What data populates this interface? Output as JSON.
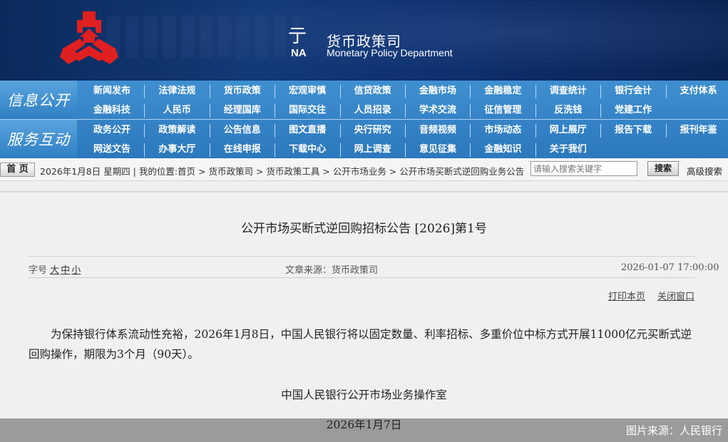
{
  "header": {
    "partial_char": "亍",
    "partial_na": "NA",
    "dept_cn": "货币政策司",
    "dept_en": "Monetary Policy Department",
    "logo_color": "#e02020"
  },
  "nav": {
    "groups": [
      {
        "title": "信息公开",
        "row1": [
          "新闻发布",
          "法律法规",
          "货币政策",
          "宏观审慎",
          "信贷政策",
          "金融市场",
          "金融稳定",
          "调查统计",
          "银行会计",
          "支付体系"
        ],
        "row2": [
          "金融科技",
          "人民币",
          "经理国库",
          "国际交往",
          "人员招录",
          "学术交流",
          "征信管理",
          "反洗钱",
          "党建工作"
        ]
      },
      {
        "title": "服务互动",
        "row1": [
          "政务公开",
          "政策解读",
          "公告信息",
          "图文直播",
          "央行研究",
          "音频视频",
          "市场动态",
          "网上展厅",
          "报告下载",
          "报刊年鉴"
        ],
        "row2": [
          "网送文告",
          "办事大厅",
          "在线申报",
          "下载中心",
          "网上调查",
          "意见征集",
          "金融知识",
          "关于我们"
        ]
      }
    ]
  },
  "breadcrumb": {
    "home": "首 页",
    "text": "2026年1月8日 星期四 | 我的位置:首页 > 货币政策司 > 货币政策工具 > 公开市场业务 > 公开市场买断式逆回购业务公告",
    "search_placeholder": "请输入搜索关键字",
    "search_button": "搜索",
    "advanced": "高级搜索"
  },
  "article": {
    "title": "公开市场买断式逆回购招标公告 [2026]第1号",
    "font_label": "字号",
    "size_large": "大",
    "size_medium": "中",
    "size_small": "小",
    "source": "文章来源：货币政策司",
    "datetime": "2026-01-07 17:00:00",
    "print": "打印本页",
    "close": "关闭窗口",
    "body": "为保持银行体系流动性充裕，2026年1月8日，中国人民银行将以固定数量、利率招标、多重价位中标方式开展11000亿元买断式逆回购操作，期限为3个月（90天）。",
    "signature": "中国人民银行公开市场业务操作室",
    "date": "2026年1月7日"
  },
  "credit": "图片来源：人民银行"
}
